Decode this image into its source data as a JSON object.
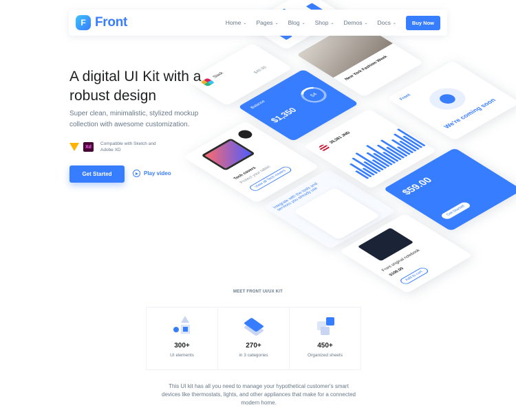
{
  "header": {
    "logo_text": "Front",
    "logo_letter": "F",
    "nav": [
      {
        "label": "Home"
      },
      {
        "label": "Pages"
      },
      {
        "label": "Blog"
      },
      {
        "label": "Shop"
      },
      {
        "label": "Demos"
      },
      {
        "label": "Docs"
      }
    ],
    "buy_label": "Buy Now"
  },
  "hero": {
    "title": "A digital UI Kit with a robust design",
    "subtitle": "Super clean, minimalistic, stylized mockup collection with awesome customization.",
    "compat_text": "Compatible with Sketch and Adobe XD",
    "xd_label": "Xd",
    "cta_label": "Get Started",
    "play_label": "Play video"
  },
  "mockups": {
    "price_top": "$49.99",
    "product_title": "Tech covers",
    "product_sub": "Protect your tablet",
    "product_btn": "View all Tech covers",
    "slack_label": "Slack",
    "balance_label": "Balance",
    "balance_value": "$1,350",
    "balance_ring": "54",
    "fashion_title": "New York Fashion Week",
    "notes_title": "Integrate with the tools and services you already use",
    "amount_value": "35,381 JND",
    "notebook_title": "Front original notebook",
    "notebook_price": "$109.00",
    "notebook_btn": "Add to cart",
    "front_card_logo": "Front",
    "coming_soon": "We're coming soon",
    "price_card_value": "$59.00",
    "price_card_btn": "Get Started",
    "amount_small": "$12.00"
  },
  "section": {
    "eyebrow": "MEET FRONT UI/UX KIT",
    "stats": [
      {
        "value": "300+",
        "label": "UI elements",
        "icon": "shapes-icon"
      },
      {
        "value": "270+",
        "label": "in 3 categories",
        "icon": "layers-icon"
      },
      {
        "value": "450+",
        "label": "Organized sheets",
        "icon": "puzzle-icon"
      }
    ],
    "description": "This UI kit has all you need to manage your hypothetical customer's smart devices like thermostats, lights, and other appliances that make for a connected modern home."
  },
  "colors": {
    "primary": "#377dff",
    "text": "#1e2022",
    "muted": "#677788",
    "sketch": "#fdb300",
    "xd_bg": "#470137"
  }
}
